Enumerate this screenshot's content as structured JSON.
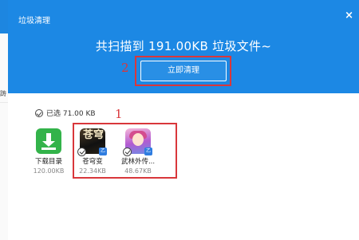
{
  "background": {
    "side_glyph": "踌"
  },
  "dialog": {
    "title": "垃圾清理",
    "close_symbol": "×",
    "headline": "共扫描到 191.00KB 垃圾文件~",
    "clean_button_label": "立即清理"
  },
  "annotations": {
    "button_number": "2",
    "apps_number": "1"
  },
  "selection": {
    "label": "已选 71.00 KB"
  },
  "apps": [
    {
      "name": "下载目录",
      "size": "120.00KB",
      "icon": "download-icon"
    },
    {
      "name": "苍穹变",
      "size": "22.34KB",
      "icon": "game-icon",
      "icon_glyph": "苍穹",
      "tag": "乙"
    },
    {
      "name": "武林外传...",
      "size": "48.67KB",
      "icon": "game-icon",
      "tag": "乙"
    }
  ],
  "colors": {
    "header_blue": "#1c88e4",
    "annotation_red": "#d9373b",
    "download_green": "#33b34a"
  }
}
